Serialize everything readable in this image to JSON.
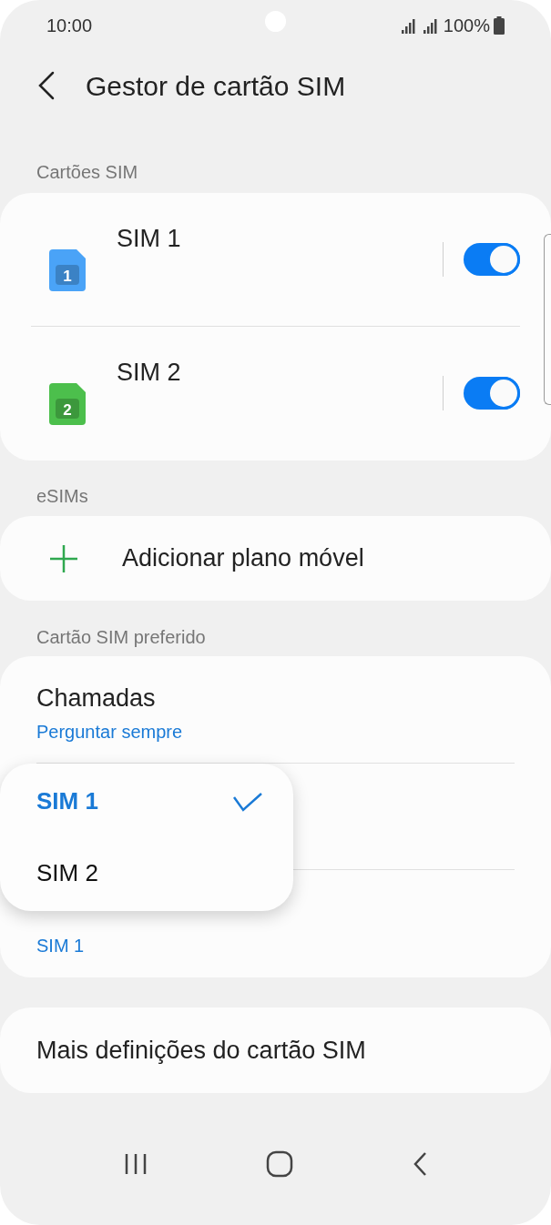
{
  "status_bar": {
    "time": "10:00",
    "battery": "100%"
  },
  "header": {
    "title": "Gestor de cartão SIM"
  },
  "sim_section": {
    "label": "Cartões SIM",
    "sims": [
      {
        "name": "SIM 1",
        "badge": "1",
        "color": "#4aa3f7",
        "on": true
      },
      {
        "name": "SIM 2",
        "badge": "2",
        "color": "#4cbf4c",
        "on": true
      }
    ]
  },
  "esim_section": {
    "label": "eSIMs",
    "add_label": "Adicionar plano móvel"
  },
  "preferred_section": {
    "label": "Cartão SIM preferido",
    "rows": [
      {
        "title": "Chamadas",
        "value": "Perguntar sempre"
      },
      {
        "value": "SIM 1"
      }
    ]
  },
  "popup_menu": {
    "options": [
      {
        "label": "SIM 1",
        "selected": true
      },
      {
        "label": "SIM 2",
        "selected": false
      }
    ]
  },
  "more_settings": {
    "label": "Mais definições do cartão SIM"
  }
}
